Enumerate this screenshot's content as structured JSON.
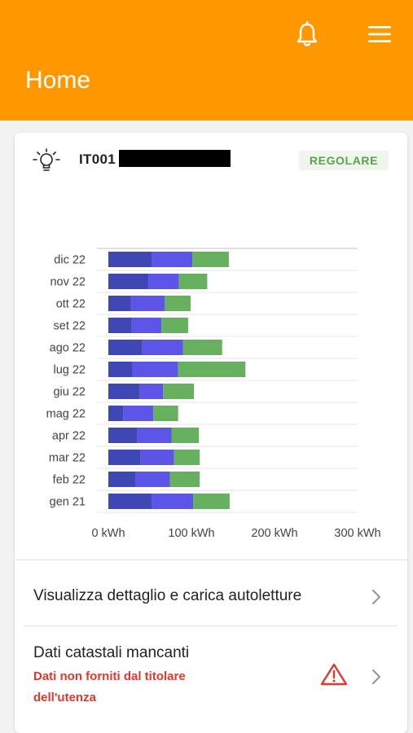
{
  "header": {
    "title": "Home",
    "icons": [
      "bell-icon",
      "menu-icon"
    ]
  },
  "supply": {
    "pod_code": "IT001",
    "status": "REGOLARE",
    "status_color": "#5aa34e"
  },
  "chart_data": {
    "type": "bar",
    "orientation": "horizontal",
    "stacked": true,
    "categories": [
      "dic 22",
      "nov 22",
      "ott 22",
      "set 22",
      "ago 22",
      "lug 22",
      "giu 22",
      "mag 22",
      "apr 22",
      "mar 22",
      "feb 22",
      "gen 21"
    ],
    "series": [
      {
        "color": "#3f47b5",
        "values": [
          52,
          48,
          27,
          28,
          41,
          29,
          38,
          18,
          35,
          39,
          33,
          52
        ]
      },
      {
        "color": "#5d55e8",
        "values": [
          49,
          37,
          41,
          36,
          49,
          55,
          28,
          36,
          41,
          40,
          41,
          50
        ]
      },
      {
        "color": "#66b060",
        "values": [
          44,
          34,
          31,
          32,
          47,
          81,
          37,
          30,
          33,
          31,
          36,
          44
        ]
      }
    ],
    "x_ticks": [
      "0 kWh",
      "100 kWh",
      "200 kWh",
      "300 kWh"
    ],
    "xlim": [
      0,
      300
    ],
    "grid": true
  },
  "rows": {
    "readings": {
      "label": "Visualizza dettaglio e carica autoletture"
    },
    "cadastral": {
      "label": "Dati catastali mancanti",
      "sub": "Dati non forniti dal titolare dell'utenza"
    }
  },
  "colors": {
    "accent": "#ff9800",
    "warning": "#e0382d"
  }
}
